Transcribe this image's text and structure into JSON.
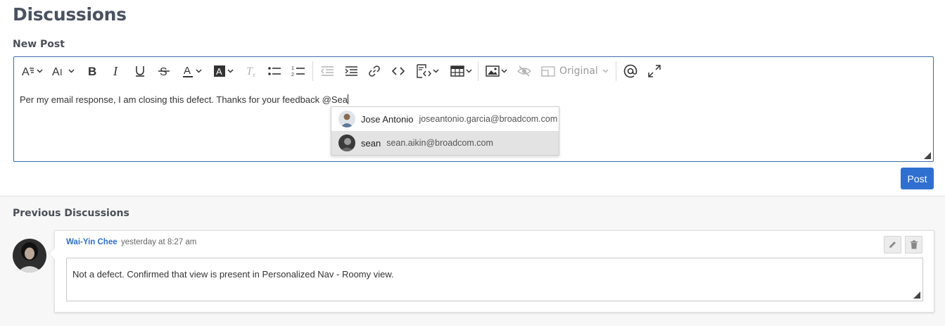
{
  "page": {
    "title": "Discussions"
  },
  "new_post": {
    "label": "New Post",
    "content_text": "Per my email response, I am closing this defect. Thanks for your feedback @Sea",
    "image_size_option": "Original",
    "post_label": "Post"
  },
  "toolbar_icons": [
    "paragraph-format-icon",
    "font-size-icon",
    "bold-icon",
    "italic-icon",
    "underline-icon",
    "strikethrough-icon",
    "text-color-icon",
    "background-color-icon",
    "clear-formatting-icon",
    "bullet-list-icon",
    "numbered-list-icon",
    "outdent-icon",
    "indent-icon",
    "link-icon",
    "code-icon",
    "source-editing-icon",
    "table-icon",
    "image-icon",
    "hide-icon",
    "image-resize-icon",
    "mention-icon",
    "fullscreen-icon"
  ],
  "mention_suggestions": [
    {
      "name": "Jose Antonio",
      "email": "joseantonio.garcia@broadcom.com",
      "selected": false
    },
    {
      "name": "sean",
      "email": "sean.aikin@broadcom.com",
      "selected": true
    }
  ],
  "previous": {
    "label": "Previous Discussions",
    "comments": [
      {
        "author": "Wai-Yin Chee",
        "time": "yesterday at 8:27 am",
        "text": "Not a defect. Confirmed that view is present in Personalized Nav - Roomy view."
      }
    ]
  },
  "colors": {
    "accent": "#2f6fd0",
    "editor_border": "#3b6ea8",
    "selected_row": "#e3e3e3"
  }
}
